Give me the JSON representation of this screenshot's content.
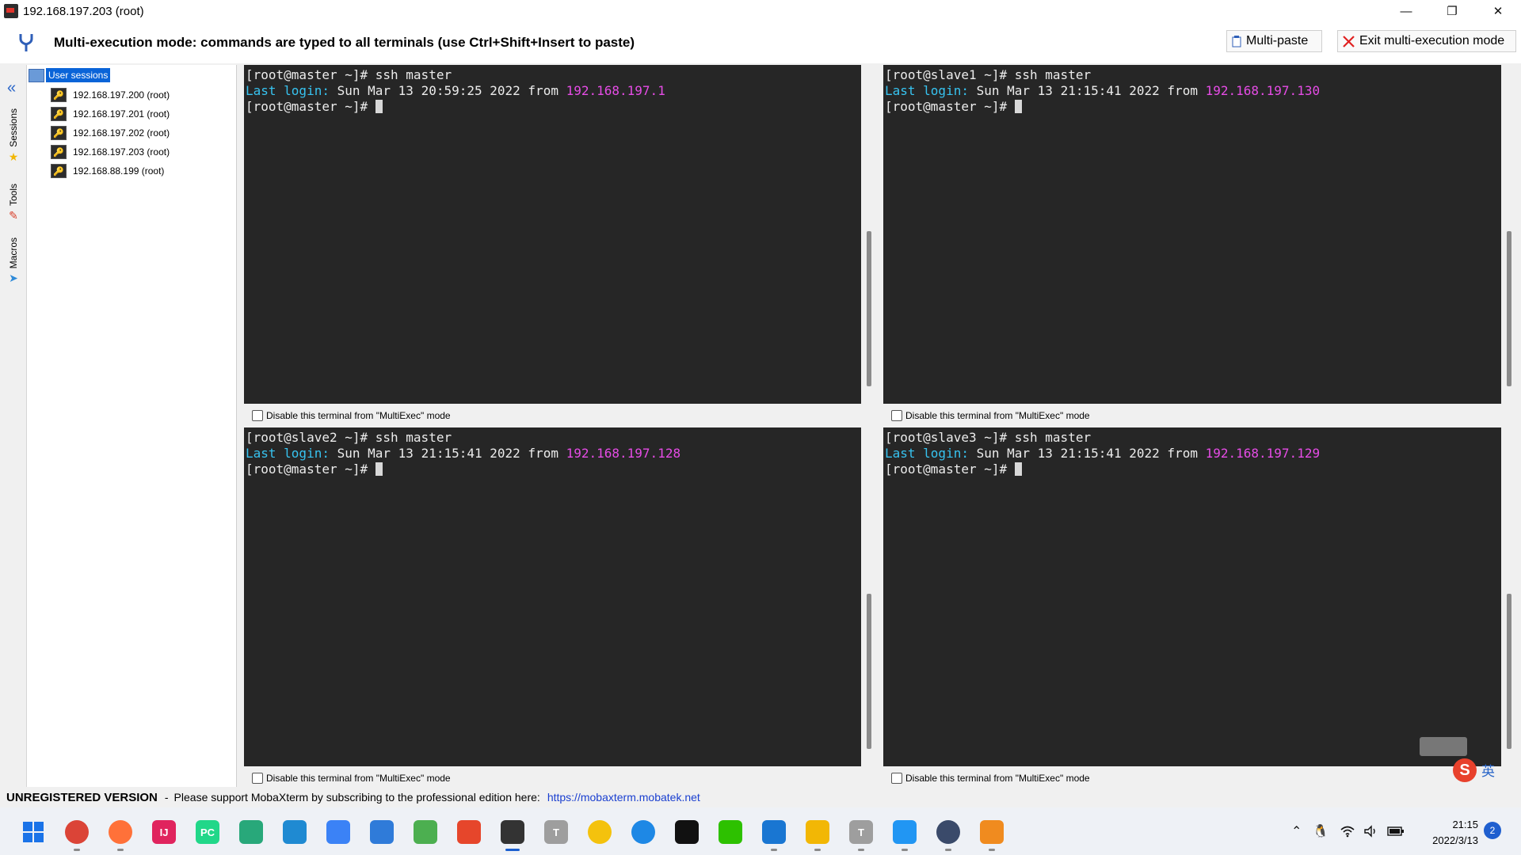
{
  "window": {
    "title": "192.168.197.203 (root)",
    "minimize": "—",
    "restore": "❐",
    "close": "✕"
  },
  "multiexec": {
    "message": "Multi-execution mode: commands are typed to all terminals (use Ctrl+Shift+Insert to paste)",
    "multi_paste": "Multi-paste",
    "exit": "Exit multi-execution mode"
  },
  "sidebar": {
    "tabs": [
      {
        "label": "Sessions"
      },
      {
        "label": "Tools"
      },
      {
        "label": "Macros"
      }
    ],
    "root": "User sessions",
    "sessions": [
      {
        "label": "192.168.197.200 (root)"
      },
      {
        "label": "192.168.197.201 (root)"
      },
      {
        "label": "192.168.197.202 (root)"
      },
      {
        "label": "192.168.197.203 (root)"
      },
      {
        "label": "192.168.88.199 (root)"
      }
    ]
  },
  "terminals": [
    {
      "line1": "[root@master ~]# ssh master",
      "last_login": "Last login:",
      "when": " Sun Mar 13 20:59:25 2022 from ",
      "ip": "192.168.197.1",
      "prompt": "[root@master ~]# ",
      "checkbox": "Disable this terminal from \"MultiExec\" mode"
    },
    {
      "line1": "[root@slave1 ~]# ssh master",
      "last_login": "Last login:",
      "when": " Sun Mar 13 21:15:41 2022 from ",
      "ip": "192.168.197.130",
      "prompt": "[root@master ~]# ",
      "checkbox": "Disable this terminal from \"MultiExec\" mode"
    },
    {
      "line1": "[root@slave2 ~]# ssh master",
      "last_login": "Last login:",
      "when": " Sun Mar 13 21:15:41 2022 from ",
      "ip": "192.168.197.128",
      "prompt": "[root@master ~]# ",
      "checkbox": "Disable this terminal from \"MultiExec\" mode"
    },
    {
      "line1": "[root@slave3 ~]# ssh master",
      "last_login": "Last login:",
      "when": " Sun Mar 13 21:15:41 2022 from ",
      "ip": "192.168.197.129",
      "prompt": "[root@master ~]# ",
      "checkbox": "Disable this terminal from \"MultiExec\" mode"
    }
  ],
  "status": {
    "unregistered": "UNREGISTERED VERSION",
    "separator": "-",
    "message": "Please support MobaXterm by subscribing to the professional edition here:",
    "link": "https://mobaxterm.mobatek.net"
  },
  "ime": {
    "s": "S",
    "lang": "英"
  },
  "taskbar": {
    "apps": [
      {
        "icon": "windows-start-icon",
        "text": "",
        "color": "#1a73e8"
      },
      {
        "icon": "chrome-icon",
        "text": "",
        "color": "#db4437"
      },
      {
        "icon": "firefox-icon",
        "text": "",
        "color": "#ff7139"
      },
      {
        "icon": "intellij-icon",
        "text": "IJ",
        "color": "#e0245e"
      },
      {
        "icon": "pycharm-icon",
        "text": "PC",
        "color": "#21d789"
      },
      {
        "icon": "app-green-icon",
        "text": "",
        "color": "#28a87a"
      },
      {
        "icon": "vscode-icon",
        "text": "",
        "color": "#1f8ad2"
      },
      {
        "icon": "browser-icon",
        "text": "",
        "color": "#3b82f6"
      },
      {
        "icon": "dolphin-icon",
        "text": "",
        "color": "#2f7bd9"
      },
      {
        "icon": "money-icon",
        "text": "",
        "color": "#4caf50"
      },
      {
        "icon": "snail-icon",
        "text": "",
        "color": "#e6462b"
      },
      {
        "icon": "mobaxterm-icon",
        "text": "",
        "color": "#333333"
      },
      {
        "icon": "typora-icon",
        "text": "T",
        "color": "#9e9e9e"
      },
      {
        "icon": "music-icon",
        "text": "",
        "color": "#f4c20d"
      },
      {
        "icon": "feishu-icon",
        "text": "",
        "color": "#1e88e5"
      },
      {
        "icon": "qq-icon",
        "text": "",
        "color": "#111111"
      },
      {
        "icon": "wechat-icon",
        "text": "",
        "color": "#2dc100"
      },
      {
        "icon": "network-icon",
        "text": "",
        "color": "#1976d2"
      },
      {
        "icon": "folder-icon",
        "text": "",
        "color": "#f2b705"
      },
      {
        "icon": "typora2-icon",
        "text": "T",
        "color": "#9e9e9e"
      },
      {
        "icon": "send-icon",
        "text": "",
        "color": "#2196f3"
      },
      {
        "icon": "avatar-icon",
        "text": "",
        "color": "#3a4a6a"
      },
      {
        "icon": "vmware-icon",
        "text": "",
        "color": "#f08b1f"
      }
    ],
    "time": "21:15",
    "date": "2022/3/13",
    "notifications": "2"
  }
}
